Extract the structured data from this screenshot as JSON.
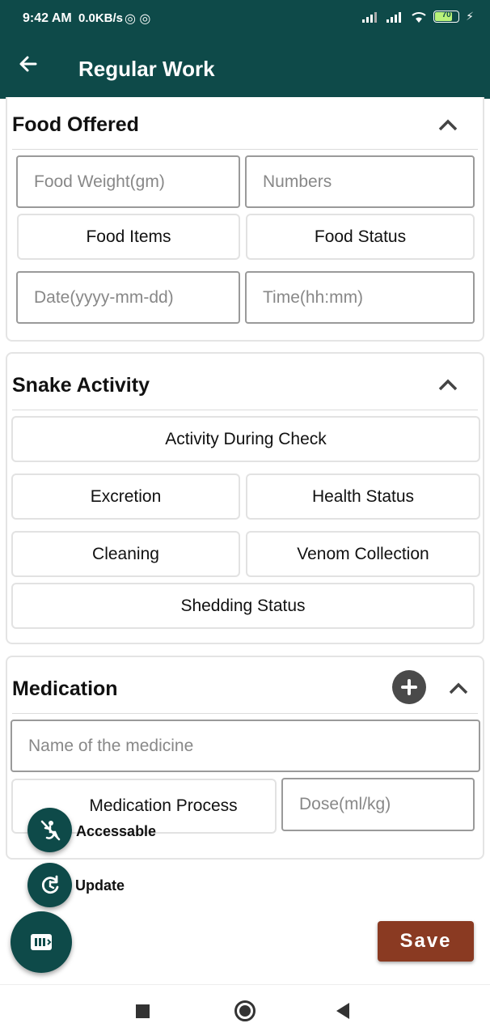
{
  "status_bar": {
    "time": "9:42 AM",
    "network_speed": "0.0KB/s",
    "battery": "70"
  },
  "app_bar": {
    "back_icon": "arrow-left-icon",
    "title": "Regular Work"
  },
  "food_offered": {
    "title": "Food Offered",
    "weight_placeholder": "Food Weight(gm)",
    "numbers_placeholder": "Numbers",
    "food_items_label": "Food Items",
    "food_status_label": "Food Status",
    "date_placeholder": "Date(yyyy-mm-dd)",
    "time_placeholder": "Time(hh:mm)"
  },
  "snake_activity": {
    "title": "Snake Activity",
    "activity_label": "Activity During Check",
    "excretion_label": "Excretion",
    "health_label": "Health Status",
    "cleaning_label": "Cleaning",
    "venom_label": "Venom Collection",
    "shedding_label": "Shedding Status"
  },
  "medication": {
    "title": "Medication",
    "medicine_placeholder": "Name of the medicine",
    "process_label": "Medication Process",
    "dose_placeholder": "Dose(ml/kg)"
  },
  "fab_menu": {
    "accessable_label": "Accessable",
    "update_label": "Update"
  },
  "save_label": "Save",
  "colors": {
    "primary": "#0e4a49",
    "save": "#8a3a22"
  }
}
